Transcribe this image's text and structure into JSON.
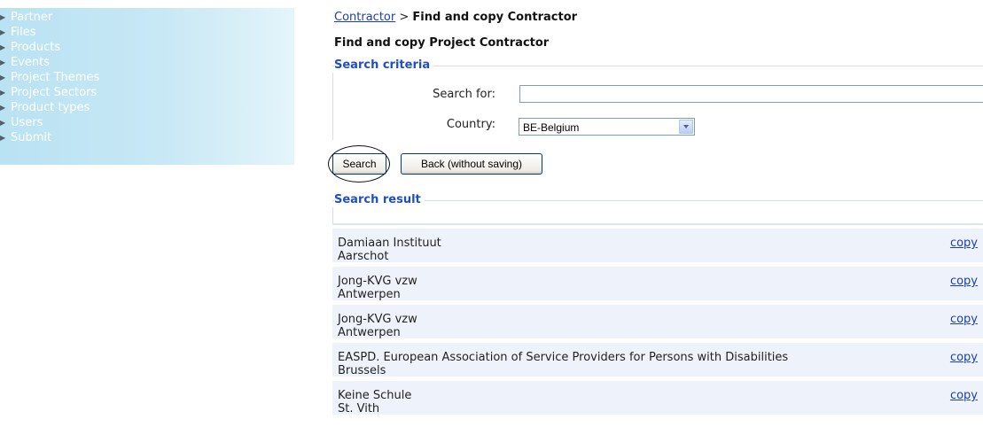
{
  "sidebar": {
    "items": [
      {
        "label": "Partner"
      },
      {
        "label": "Files"
      },
      {
        "label": "Products"
      },
      {
        "label": "Events"
      },
      {
        "label": "Project Themes"
      },
      {
        "label": "Project Sectors"
      },
      {
        "label": "Product types"
      },
      {
        "label": "Users"
      },
      {
        "label": "Submit"
      }
    ]
  },
  "breadcrumb": {
    "parent": "Contractor",
    "separator": ">",
    "current": "Find and copy Contractor"
  },
  "page_title": "Find and copy Project Contractor",
  "criteria": {
    "legend": "Search criteria",
    "search_label": "Search for:",
    "search_value": "",
    "country_label": "Country:",
    "country_value": "BE-Belgium"
  },
  "buttons": {
    "search": "Search",
    "back": "Back (without saving)"
  },
  "results": {
    "legend": "Search result",
    "copy_label": "copy",
    "items": [
      {
        "name": "Damiaan Instituut",
        "city": "Aarschot"
      },
      {
        "name": "Jong-KVG vzw",
        "city": "Antwerpen"
      },
      {
        "name": "Jong-KVG vzw",
        "city": "Antwerpen"
      },
      {
        "name": "EASPD. European Association of Service Providers for Persons with Disabilities",
        "city": "Brussels"
      },
      {
        "name": "Keine Schule",
        "city": "St. Vith"
      }
    ]
  },
  "colors": {
    "link": "#1a3fb0",
    "legend": "#1f4fc8",
    "sidebar_bg": "#c8e8f5",
    "result_bg": "#eef2fb"
  }
}
